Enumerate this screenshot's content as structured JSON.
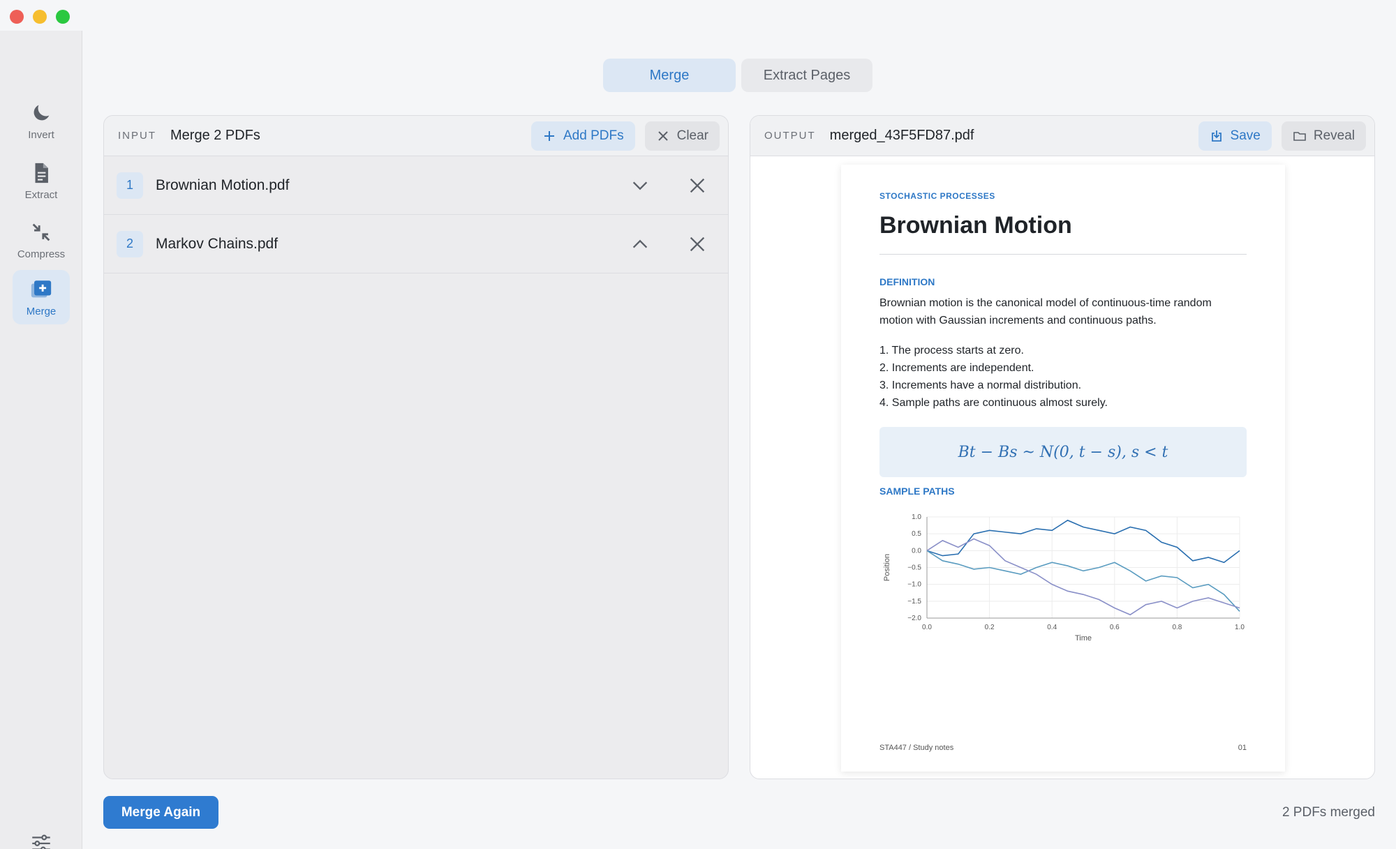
{
  "sidebar": {
    "items": [
      {
        "label": "Invert",
        "icon": "moon-icon"
      },
      {
        "label": "Extract",
        "icon": "document-icon"
      },
      {
        "label": "Compress",
        "icon": "compress-arrows-icon"
      },
      {
        "label": "Merge",
        "icon": "merge-stack-icon",
        "active": true
      }
    ]
  },
  "tabs": [
    {
      "label": "Merge",
      "active": true
    },
    {
      "label": "Extract Pages",
      "active": false
    }
  ],
  "input_panel": {
    "tag": "INPUT",
    "title": "Merge 2 PDFs",
    "add_label": "Add PDFs",
    "clear_label": "Clear",
    "files": [
      {
        "index": "1",
        "name": "Brownian Motion.pdf",
        "toggle": "chevron-down-icon"
      },
      {
        "index": "2",
        "name": "Markov Chains.pdf",
        "toggle": "chevron-up-icon"
      }
    ]
  },
  "output_panel": {
    "tag": "OUTPUT",
    "filename": "merged_43F5FD87.pdf",
    "save_label": "Save",
    "reveal_label": "Reveal"
  },
  "document": {
    "kicker": "STOCHASTIC PROCESSES",
    "title": "Brownian Motion",
    "definition_heading": "DEFINITION",
    "definition_text": "Brownian motion is the canonical model of continuous-time random motion with Gaussian increments and continuous paths.",
    "list": [
      "1. The process starts at zero.",
      "2. Increments are independent.",
      "3. Increments have a normal distribution.",
      "4. Sample paths are continuous almost surely."
    ],
    "formula": "Bt − Bs ~ N(0, t − s),    s < t",
    "sample_heading": "SAMPLE PATHS",
    "footer_left": "STA447  /  Study notes",
    "footer_right": "01"
  },
  "chart_data": {
    "type": "line",
    "xlabel": "Time",
    "ylabel": "Position",
    "xlim": [
      0.0,
      1.0
    ],
    "ylim": [
      -2.0,
      1.0
    ],
    "xticks": [
      "0.0",
      "0.2",
      "0.4",
      "0.6",
      "0.8",
      "1.0"
    ],
    "yticks": [
      "1.0",
      "0.5",
      "0.0",
      "−0.5",
      "−1.0",
      "−1.5",
      "−2.0"
    ],
    "series": [
      {
        "color": "#2a6fb0",
        "x": [
          0.0,
          0.05,
          0.1,
          0.15,
          0.2,
          0.25,
          0.3,
          0.35,
          0.4,
          0.45,
          0.5,
          0.55,
          0.6,
          0.65,
          0.7,
          0.75,
          0.8,
          0.85,
          0.9,
          0.95,
          1.0
        ],
        "y": [
          0.0,
          -0.15,
          -0.1,
          0.5,
          0.6,
          0.55,
          0.5,
          0.65,
          0.6,
          0.9,
          0.7,
          0.6,
          0.5,
          0.7,
          0.6,
          0.25,
          0.1,
          -0.3,
          -0.2,
          -0.35,
          0.0
        ]
      },
      {
        "color": "#5a9cc0",
        "x": [
          0.0,
          0.05,
          0.1,
          0.15,
          0.2,
          0.25,
          0.3,
          0.35,
          0.4,
          0.45,
          0.5,
          0.55,
          0.6,
          0.65,
          0.7,
          0.75,
          0.8,
          0.85,
          0.9,
          0.95,
          1.0
        ],
        "y": [
          0.0,
          -0.3,
          -0.4,
          -0.55,
          -0.5,
          -0.6,
          -0.7,
          -0.5,
          -0.35,
          -0.45,
          -0.6,
          -0.5,
          -0.35,
          -0.6,
          -0.9,
          -0.75,
          -0.8,
          -1.1,
          -1.0,
          -1.3,
          -1.8
        ]
      },
      {
        "color": "#8a90c8",
        "x": [
          0.0,
          0.05,
          0.1,
          0.15,
          0.2,
          0.25,
          0.3,
          0.35,
          0.4,
          0.45,
          0.5,
          0.55,
          0.6,
          0.65,
          0.7,
          0.75,
          0.8,
          0.85,
          0.9,
          0.95,
          1.0
        ],
        "y": [
          0.0,
          0.3,
          0.1,
          0.35,
          0.15,
          -0.3,
          -0.5,
          -0.7,
          -1.0,
          -1.2,
          -1.3,
          -1.45,
          -1.7,
          -1.9,
          -1.6,
          -1.5,
          -1.7,
          -1.5,
          -1.4,
          -1.55,
          -1.7
        ]
      }
    ]
  },
  "footer": {
    "merge_again_label": "Merge Again",
    "status": "2 PDFs merged"
  }
}
